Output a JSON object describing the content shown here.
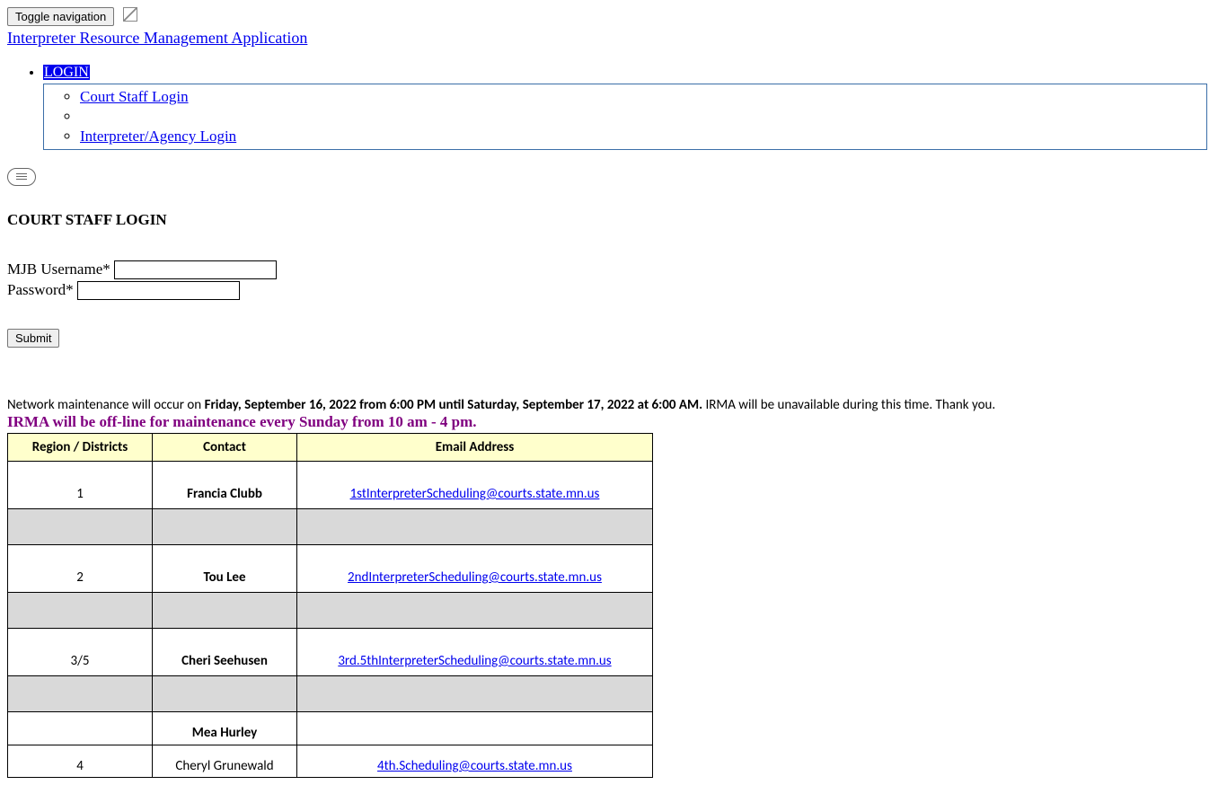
{
  "header": {
    "toggle_label": "Toggle navigation",
    "app_title": "Interpreter Resource Management Application"
  },
  "nav": {
    "login_label": "LOGIN",
    "items": [
      "Court Staff Login",
      "",
      "Interpreter/Agency Login"
    ]
  },
  "page_title": "COURT STAFF LOGIN",
  "form": {
    "username_label": "MJB Username*",
    "password_label": "Password*",
    "submit_label": "Submit"
  },
  "notice": {
    "prefix": "Network maintenance will occur on ",
    "bold_window": "Friday, September 16, 2022 from 6:00 PM until Saturday, September 17, 2022 at 6:00 AM.",
    "suffix": "  IRMA will be unavailable during this time.  Thank you.",
    "weekly": "IRMA will be off-line for maintenance every Sunday from 10 am - 4 pm."
  },
  "table": {
    "headers": [
      "Region / Districts",
      "Contact",
      "Email Address"
    ],
    "rows": [
      {
        "region": "1",
        "contact": "Francia Clubb",
        "email": "1stInterpreterScheduling@courts.state.mn.us"
      },
      {
        "region": "2",
        "contact": "Tou Lee",
        "email": "2ndInterpreterScheduling@courts.state.mn.us"
      },
      {
        "region": "3/5",
        "contact": "Cheri Seehusen",
        "email": "3rd.5thInterpreterScheduling@courts.state.mn.us"
      },
      {
        "region": "4",
        "contact_top": "Mea Hurley",
        "contact_bot": "Cheryl Grunewald",
        "email": "4th.Scheduling@courts.state.mn.us"
      }
    ]
  }
}
